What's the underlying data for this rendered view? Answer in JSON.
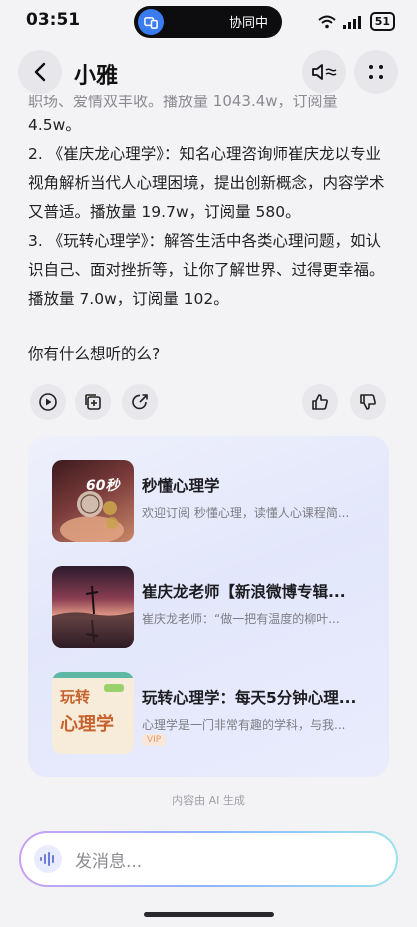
{
  "status_bar": {
    "time": "03:51",
    "island_text": "协同中",
    "battery": "51"
  },
  "header": {
    "title": "小雅"
  },
  "message": {
    "partial_line": "职场、爱情双丰收。播放量 1043.4w，订阅量",
    "line_tail": "4.5w。",
    "items": [
      "2. 《崔庆龙心理学》：知名心理咨询师崔庆龙以专业视角解析当代人心理困境，提出创新概念，内容学术又普适。播放量 19.7w，订阅量 580。",
      "3. 《玩转心理学》：解答生活中各类心理问题，如认识自己、面对挫折等，让你了解世界、过得更幸福。播放量 7.0w，订阅量 102。"
    ],
    "question": "你有什么想听的么?"
  },
  "recommendations": [
    {
      "title": "秒懂心理学",
      "desc": "欢迎订阅 秒懂心理，读懂人心课程简...",
      "thumb_text": "60秒"
    },
    {
      "title": "崔庆龙老师【新浪微博专辑...",
      "desc": "崔庆龙老师：“做一把有温度的柳叶..."
    },
    {
      "title": "玩转心理学：每天5分钟心理...",
      "desc": "心理学是一门非常有趣的学科，与我...",
      "badge": "VIP",
      "thumb_text_top": "玩转",
      "thumb_text_bottom": "心理学"
    }
  ],
  "footer_note": "内容由 AI 生成",
  "input": {
    "placeholder": "发消息..."
  },
  "colors": {
    "accent": "#3a7bf0",
    "card_bg": "#e6e9fb",
    "input_gradient": [
      "#c9a2f2",
      "#8fb4ff",
      "#9ae3e8"
    ]
  }
}
